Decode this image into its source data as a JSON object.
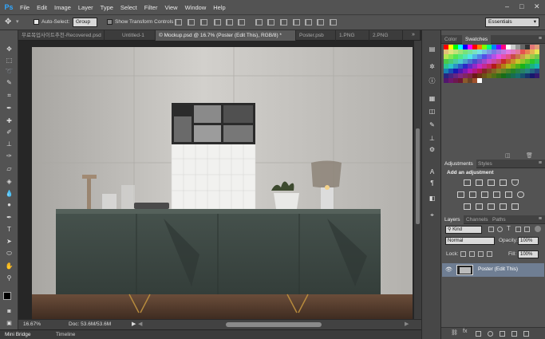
{
  "app": {
    "logo": "Ps"
  },
  "menu": [
    "File",
    "Edit",
    "Image",
    "Layer",
    "Type",
    "Select",
    "Filter",
    "View",
    "Window",
    "Help"
  ],
  "window_controls": {
    "minimize": "–",
    "maximize": "□",
    "close": "✕"
  },
  "options_bar": {
    "auto_select_label": "Auto-Select:",
    "auto_select_value": "Group",
    "transform_label": "Show Transform Controls",
    "workspace": "Essentials"
  },
  "tabs": [
    {
      "label": "무료목업사이트추천-Recovered.psd",
      "active": false
    },
    {
      "label": "Untitled-1",
      "active": false
    },
    {
      "label": "© Mockup.psd @ 16.7% (Poster (Edit This), RGB/8) *",
      "active": true
    },
    {
      "label": "Poster.psb",
      "active": false
    },
    {
      "label": "1.PNG",
      "active": false
    },
    {
      "label": "2.PNG",
      "active": false
    }
  ],
  "status": {
    "zoom": "16.67%",
    "doc": "Doc: 53.6M/53.6M"
  },
  "bottom_tabs": {
    "mini_bridge": "Mini Bridge",
    "timeline": "Timeline"
  },
  "color_panel": {
    "tab_color": "Color",
    "tab_swatches": "Swatches"
  },
  "adjustments_panel": {
    "tab_adjustments": "Adjustments",
    "tab_styles": "Styles",
    "heading": "Add an adjustment"
  },
  "layers_panel": {
    "tab_layers": "Layers",
    "tab_channels": "Channels",
    "tab_paths": "Paths",
    "filter_kind": "Kind",
    "blend_mode": "Normal",
    "opacity_label": "Opacity:",
    "opacity_value": "100%",
    "lock_label": "Lock:",
    "fill_label": "Fill:",
    "fill_value": "100%",
    "layer_name": "Poster (Edit This)"
  },
  "colors": {
    "ui_panel": "#535353",
    "ui_dark": "#282828",
    "accent_blue": "#31a8ff",
    "layer_selected": "#6f7e93",
    "cabinet": "#3e4a45",
    "wall": "#c9c7c3"
  }
}
